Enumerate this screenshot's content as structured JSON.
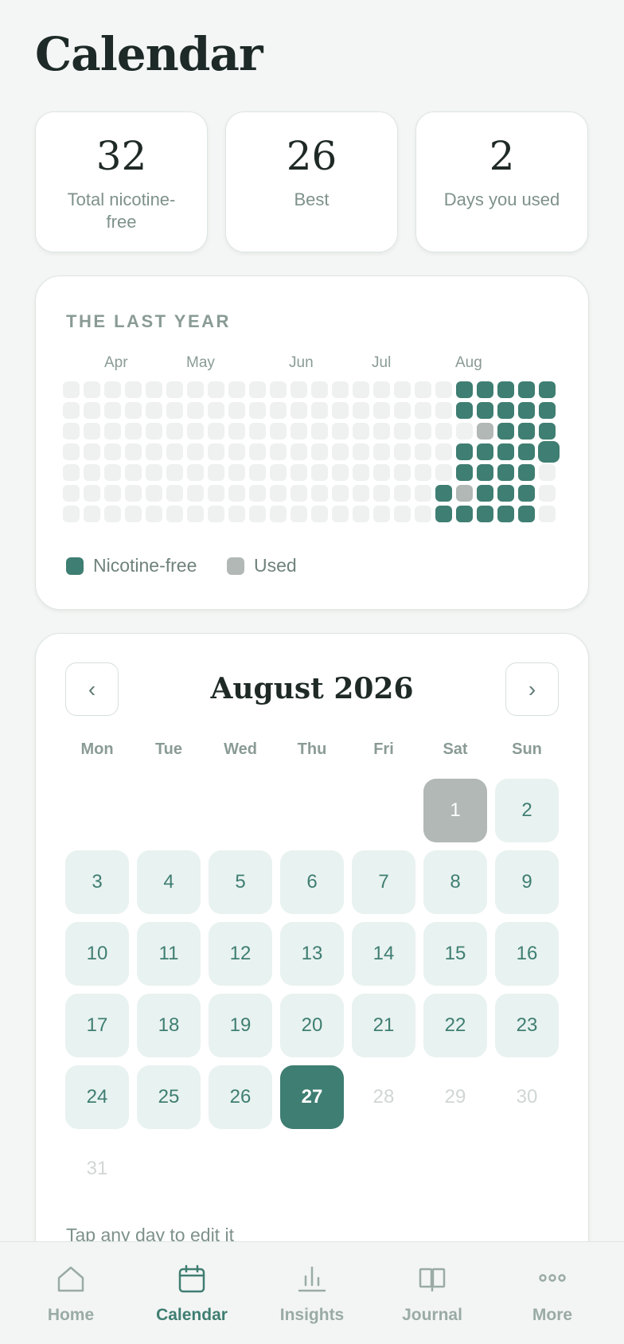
{
  "page": {
    "title": "Calendar"
  },
  "stats": [
    {
      "value": "32",
      "label": "Total nicotine-free"
    },
    {
      "value": "26",
      "label": "Best"
    },
    {
      "value": "2",
      "label": "Days you used"
    }
  ],
  "year": {
    "title": "THE LAST YEAR",
    "months": [
      "Apr",
      "May",
      "Jun",
      "Jul",
      "Aug"
    ],
    "legend": {
      "free": "Nicotine-free",
      "used": "Used"
    },
    "colors": {
      "free": "#3f7e72",
      "used": "#b2b8b5",
      "empty": "#eef1f0"
    }
  },
  "calendar": {
    "month_label": "August 2026",
    "prev_glyph": "‹",
    "next_glyph": "›",
    "weekdays": [
      "Mon",
      "Tue",
      "Wed",
      "Thu",
      "Fri",
      "Sat",
      "Sun"
    ],
    "days": [
      {
        "label": "1",
        "status": "used"
      },
      {
        "label": "2",
        "status": "free"
      },
      {
        "label": "3",
        "status": "free"
      },
      {
        "label": "4",
        "status": "free"
      },
      {
        "label": "5",
        "status": "free"
      },
      {
        "label": "6",
        "status": "free"
      },
      {
        "label": "7",
        "status": "free"
      },
      {
        "label": "8",
        "status": "free"
      },
      {
        "label": "9",
        "status": "free"
      },
      {
        "label": "10",
        "status": "free"
      },
      {
        "label": "11",
        "status": "free"
      },
      {
        "label": "12",
        "status": "free"
      },
      {
        "label": "13",
        "status": "free"
      },
      {
        "label": "14",
        "status": "free"
      },
      {
        "label": "15",
        "status": "free"
      },
      {
        "label": "16",
        "status": "free"
      },
      {
        "label": "17",
        "status": "free"
      },
      {
        "label": "18",
        "status": "free"
      },
      {
        "label": "19",
        "status": "free"
      },
      {
        "label": "20",
        "status": "free"
      },
      {
        "label": "21",
        "status": "free"
      },
      {
        "label": "22",
        "status": "free"
      },
      {
        "label": "23",
        "status": "free"
      },
      {
        "label": "24",
        "status": "free"
      },
      {
        "label": "25",
        "status": "free"
      },
      {
        "label": "26",
        "status": "free"
      },
      {
        "label": "27",
        "status": "today"
      },
      {
        "label": "28",
        "status": "future"
      },
      {
        "label": "29",
        "status": "future"
      },
      {
        "label": "30",
        "status": "future"
      },
      {
        "label": "31",
        "status": "future"
      }
    ],
    "hint": "Tap any day to edit it"
  },
  "tabs": [
    {
      "label": "Home",
      "icon": "home-icon",
      "active": false
    },
    {
      "label": "Calendar",
      "icon": "calendar-icon",
      "active": true
    },
    {
      "label": "Insights",
      "icon": "bar-chart-icon",
      "active": false
    },
    {
      "label": "Journal",
      "icon": "book-icon",
      "active": false
    },
    {
      "label": "More",
      "icon": "more-dots-icon",
      "active": false
    }
  ]
}
